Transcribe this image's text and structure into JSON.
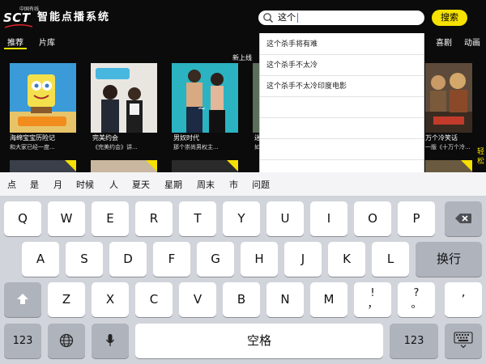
{
  "header": {
    "logo_small": "中国有线",
    "logo_main": "SCT",
    "app_title": "智能点播系统"
  },
  "search": {
    "query": "这个",
    "button_label": "搜索"
  },
  "tabs": {
    "recommend": "推荐",
    "library": "片库",
    "comedy": "喜剧",
    "animation": "动画"
  },
  "banner": {
    "new_online": "新上线"
  },
  "posters": [
    {
      "title": "海绵宝宝历险记",
      "subtitle": "和大家已经一度..."
    },
    {
      "title": "完美约会",
      "subtitle": "《完美约会》讲..."
    },
    {
      "title": "男奴时代",
      "subtitle": "那个崇尚男权主..."
    },
    {
      "title": "迷",
      "subtitle": "如"
    },
    {
      "title": "万个冷笑话",
      "subtitle": "一版《十万个冷..."
    }
  ],
  "side_yellow": "轻松",
  "suggestions": [
    "这个杀手将有难",
    "这个杀手不太冷",
    "这个杀手不太冷印度电影"
  ],
  "candidates": [
    "点",
    "是",
    "月",
    "时候",
    "人",
    "夏天",
    "星期",
    "周末",
    "市",
    "问题"
  ],
  "keys": {
    "row1": [
      "Q",
      "W",
      "E",
      "R",
      "T",
      "Y",
      "U",
      "I",
      "O",
      "P"
    ],
    "row2": [
      "A",
      "S",
      "D",
      "F",
      "G",
      "H",
      "J",
      "K",
      "L"
    ],
    "row3": [
      "Z",
      "X",
      "C",
      "V",
      "B",
      "N",
      "M"
    ],
    "exclaim_top": "!",
    "exclaim_bottom": "，",
    "question_top": "?",
    "question_bottom": "。",
    "quote": "’",
    "return_label": "换行",
    "space_label": "空格",
    "numbers_label": "123"
  },
  "colors": {
    "accent": "#f6e100",
    "keyboard_bg": "#d1d4da",
    "caret": "#2a7cff"
  },
  "icons": {
    "search": "magnifier-icon",
    "backspace": "backspace-icon",
    "shift": "shift-arrow-icon",
    "globe": "globe-icon",
    "mic": "microphone-icon",
    "hide_keyboard": "keyboard-dismiss-icon"
  }
}
